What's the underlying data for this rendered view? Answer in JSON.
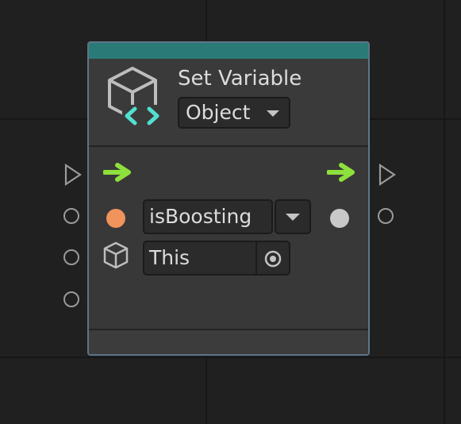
{
  "node": {
    "title": "Set Variable",
    "kind_dropdown": {
      "selected": "Object"
    },
    "icon": "variable-cube-icon",
    "inputs": {
      "control": "flow-arrow-icon",
      "name_field": {
        "value": "isBoosting",
        "port_icon": "orange-dot-icon"
      },
      "target_field": {
        "value": "This",
        "icon": "cube-icon",
        "picker_icon": "target-icon"
      },
      "value_port": "gray-dot-icon"
    },
    "outputs": {
      "control": "flow-arrow-icon",
      "value_port": "gray-dot-icon"
    }
  },
  "colors": {
    "header_accent": "#2a7b78",
    "flow_arrow": "#8ee03c",
    "string_port": "#f0935c",
    "generic_port": "#c9c9c9",
    "node_border": "#5d7587"
  }
}
